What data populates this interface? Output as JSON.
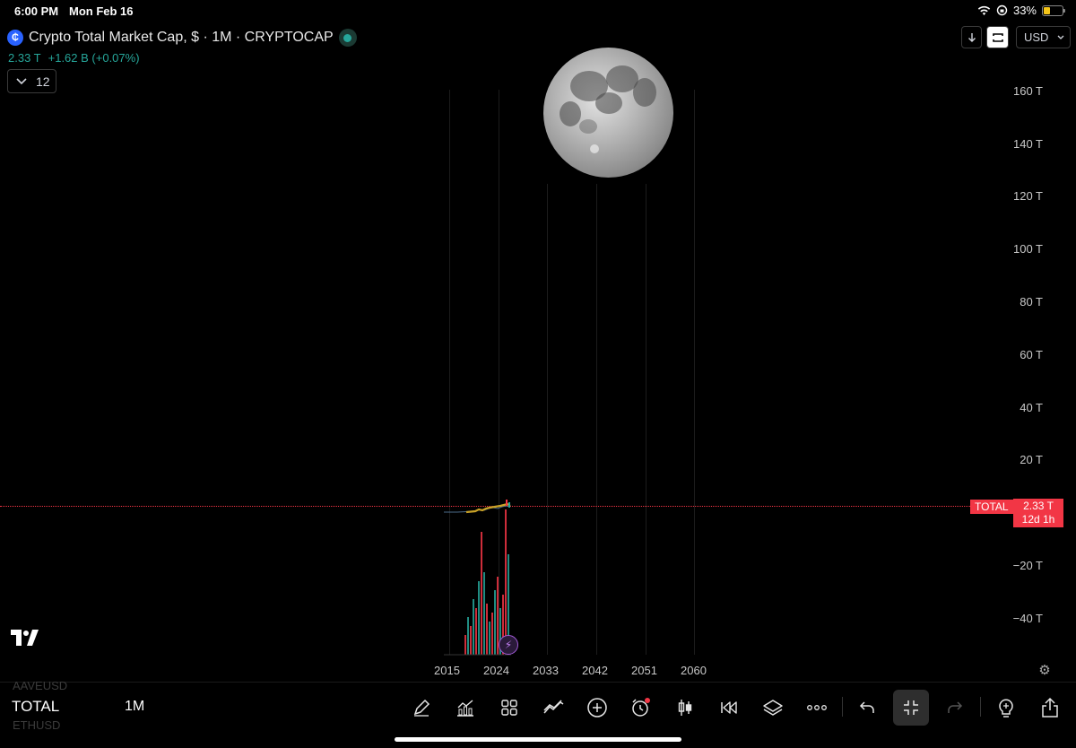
{
  "status_bar": {
    "time": "6:00 PM",
    "date": "Mon Feb 16",
    "battery": "33%",
    "battery_level": 0.33
  },
  "header": {
    "title": "Crypto Total Market Cap, $ · 1M · CRYPTOCAP",
    "logo_icon": "crypto-symbol-logo",
    "price": "2.33 T",
    "change": "+1.62 B (+0.07%)",
    "indicator_count": "12"
  },
  "top_right": {
    "currency": "USD"
  },
  "price_axis": {
    "labels": [
      "160 T",
      "140 T",
      "120 T",
      "100 T",
      "80 T",
      "60 T",
      "40 T",
      "20 T",
      "−20 T",
      "−40 T"
    ]
  },
  "time_axis": {
    "labels": [
      "2015",
      "2024",
      "2033",
      "2042",
      "2051",
      "2060"
    ]
  },
  "price_tag": {
    "symbol": "TOTAL",
    "price": "2.33 T",
    "countdown": "12d 1h"
  },
  "bottom_bar": {
    "ghost_above": "AAVEUSD",
    "symbol": "TOTAL",
    "ghost_below": "ETHUSD",
    "timeframe": "1M"
  },
  "colors": {
    "accent_red": "#f23645",
    "accent_green": "#26a69a",
    "background": "#000000"
  }
}
